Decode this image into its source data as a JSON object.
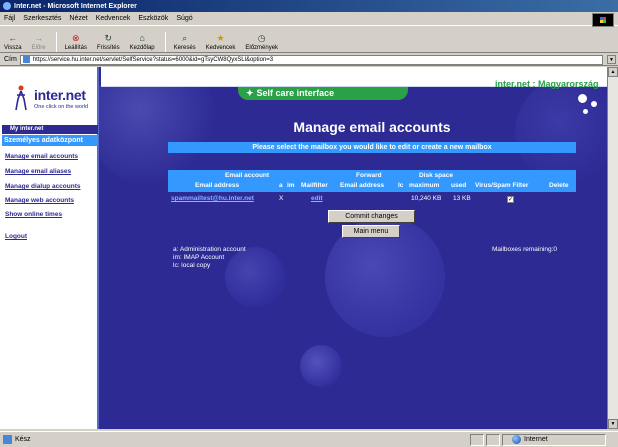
{
  "window": {
    "title": "Inter.net - Microsoft Internet Explorer"
  },
  "menu": [
    "Fájl",
    "Szerkesztés",
    "Nézet",
    "Kedvencek",
    "Eszközök",
    "Súgó"
  ],
  "toolbar": [
    {
      "label": "Vissza",
      "icon": "back-icon",
      "enabled": true
    },
    {
      "label": "Előre",
      "icon": "forward-icon",
      "enabled": false
    },
    {
      "label": "Leállítás",
      "icon": "stop-icon",
      "enabled": true
    },
    {
      "label": "Frissítés",
      "icon": "refresh-icon",
      "enabled": true
    },
    {
      "label": "Kezdőlap",
      "icon": "home-icon",
      "enabled": true
    },
    {
      "label": "Keresés",
      "icon": "search-icon",
      "enabled": true
    },
    {
      "label": "Kedvencek",
      "icon": "favorites-icon",
      "enabled": true
    },
    {
      "label": "Előzmények",
      "icon": "history-icon",
      "enabled": true
    }
  ],
  "address": {
    "label": "Cím",
    "url": "https://service.hu.inter.net/servlet/SelfService?status=6000&id=gTsyCW8QyxSLl&option=3"
  },
  "sidebar": {
    "logo_text": "inter.net",
    "logo_tagline": "One click on the world",
    "my_inter": "My inter.net",
    "section_title": "Személyes adatközpont",
    "links": [
      "Manage email accounts",
      "Manage email aliases",
      "Manage dialup accounts",
      "Manage web accounts",
      "Show online times",
      "Logout"
    ]
  },
  "header": {
    "selfcare_tab": "Self care interface",
    "brand_right": "inter.net : Magyarország"
  },
  "main": {
    "title": "Manage email accounts",
    "subtitle": "Please select the mailbox you would like to edit or create a new mailbox",
    "table": {
      "group_headers": {
        "email_account": "Email account",
        "forward": "Forward",
        "disk_space": "Disk space"
      },
      "columns": {
        "email_address": "Email address",
        "a": "a",
        "im": "im",
        "mailfilter": "Mailfilter",
        "forward_email": "Email address",
        "lc": "lc",
        "maximum": "maximum",
        "used": "used",
        "virus_spam": "Virus/Spam Filter",
        "delete": "Delete"
      },
      "rows": [
        {
          "email_address": "spammailtest@hu.inter.net",
          "a": "",
          "im": "X",
          "mailfilter": "edit",
          "forward_email": "",
          "lc": "",
          "maximum": "10,240 KB",
          "used": "13 KB",
          "virus_spam": true,
          "delete": false
        }
      ]
    },
    "commit_button": "Commit changes",
    "menu_button": "Main menu",
    "legend": [
      "a: Administration account",
      "im: IMAP Account",
      "lc: local copy"
    ],
    "mailboxes_remaining": "Mailboxes remaining:0"
  },
  "status": {
    "text": "Kész",
    "zone": "Internet"
  },
  "colors": {
    "page_bg": "#2d2a94",
    "accent_blue": "#3399ff",
    "brand_green": "#2aa146",
    "link_blue": "#7fb8ff"
  }
}
